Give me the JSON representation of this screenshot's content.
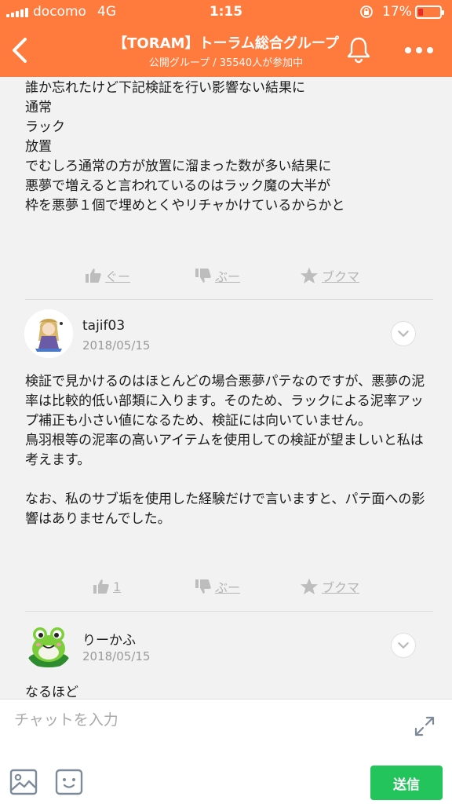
{
  "status_bar": {
    "carrier": "docomo",
    "network": "4G",
    "time": "1:15",
    "battery": "17%"
  },
  "header": {
    "title": "【TORAM】トーラム総合グループ",
    "subtitle": "公開グループ / 35540人が参加中"
  },
  "colors": {
    "header_bg": "#ff7a3d",
    "send_button": "#23c45c",
    "battery_low": "#e82b2b"
  },
  "posts": [
    {
      "text": "誰か忘れたけど下記検証を行い影響ない結果に\n通常\nラック\n放置\nでむしろ通常の方が放置に溜まった数が多い結果に\n悪夢で増えると言われているのはラック魔の大半が\n枠を悪夢１個で埋めとくやリチャかけているからかと",
      "actions": {
        "good": "ぐー",
        "bad": "ぶー",
        "bookmark": "ブクマ"
      }
    },
    {
      "username": "tajif03",
      "date": "2018/05/15",
      "text": "検証で見かけるのはほとんどの場合悪夢パテなのですが、悪夢の泥率は比較的低い部類に入ります。そのため、ラックによる泥率アップ補正も小さい値になるため、検証には向いていません。\n鳥羽根等の泥率の高いアイテムを使用しての検証が望ましいと私は考えます。\n\nなお、私のサブ垢を使用した経験だけで言いますと、パテ面への影響はありませんでした。",
      "actions": {
        "good": "1",
        "bad": "ぶー",
        "bookmark": "ブクマ"
      }
    },
    {
      "username": "りーかふ",
      "date": "2018/05/15",
      "text": "なるほど"
    }
  ],
  "input": {
    "placeholder": "チャットを入力",
    "send_label": "送信"
  },
  "icons": [
    "signal-icon",
    "lock-rotation-icon",
    "battery-icon",
    "back-arrow-icon",
    "bell-icon",
    "more-icon",
    "thumbs-up-icon",
    "thumbs-down-icon",
    "star-icon",
    "chevron-down-icon",
    "expand-icon",
    "image-icon",
    "sticker-icon"
  ]
}
